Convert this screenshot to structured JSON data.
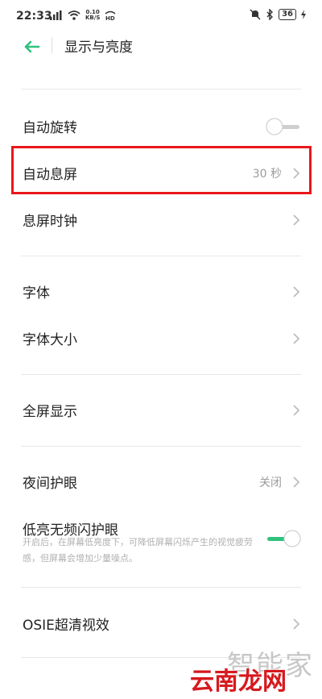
{
  "status_bar": {
    "time": "22:33",
    "speed_top": "0.10",
    "speed_bottom": "KB/S",
    "battery": "36"
  },
  "header": {
    "title": "显示与亮度"
  },
  "rows": {
    "auto_rotate": {
      "label": "自动旋转",
      "toggle_on": false
    },
    "auto_screen_off": {
      "label": "自动息屏",
      "value": "30 秒"
    },
    "screen_off_clock": {
      "label": "息屏时钟"
    },
    "font": {
      "label": "字体"
    },
    "font_size": {
      "label": "字体大小"
    },
    "full_screen": {
      "label": "全屏显示"
    },
    "night_mode": {
      "label": "夜间护眼",
      "value": "关闭"
    },
    "low_light": {
      "label": "低亮无频闪护眼",
      "description": "开启后，在屏幕低亮度下，可降低屏幕闪烁产生的视觉疲劳感，但屏幕会增加少量噪点。",
      "toggle_on": true
    },
    "osie": {
      "label": "OSIE超清视效"
    }
  },
  "watermark": {
    "gray": "智能家",
    "red": "云南龙网"
  },
  "colors": {
    "accent_green": "#2ec27e",
    "highlight_red": "#e8171b"
  }
}
